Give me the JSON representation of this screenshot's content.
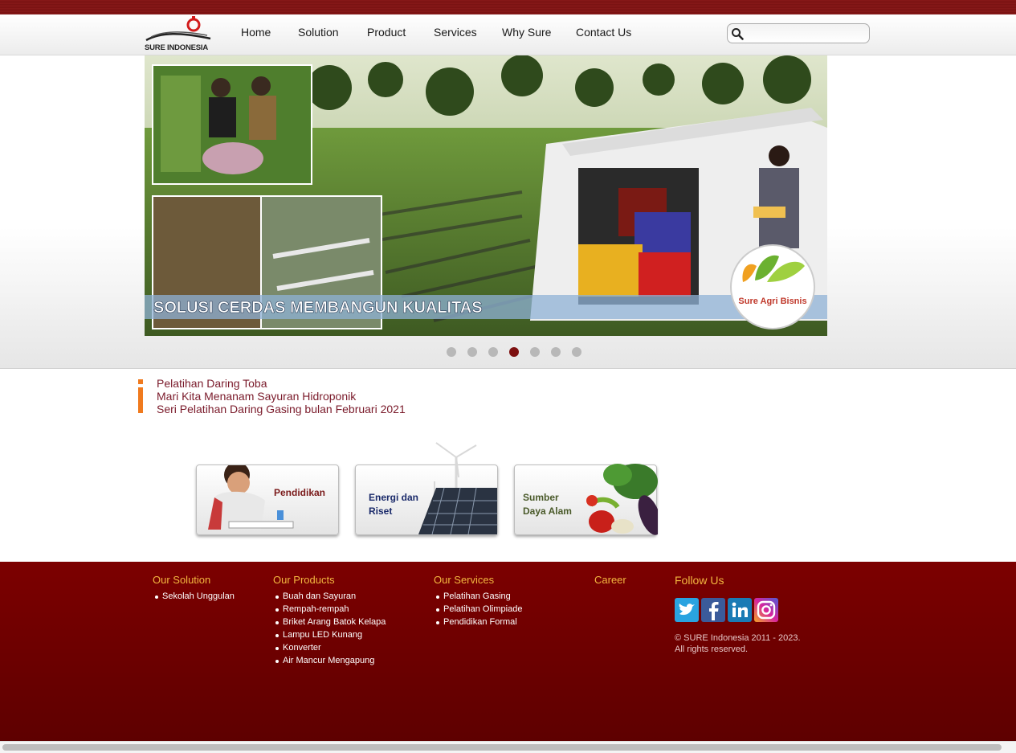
{
  "brand": {
    "name": "SURE INDONESIA",
    "logo_color": "#d21c1c"
  },
  "nav": {
    "items": [
      {
        "label": "Home"
      },
      {
        "label": "Solution"
      },
      {
        "label": "Product"
      },
      {
        "label": "Services"
      },
      {
        "label": "Why Sure"
      },
      {
        "label": "Contact Us"
      }
    ],
    "search_placeholder": "",
    "search_icon": "search-icon"
  },
  "banner": {
    "caption": "SOLUSI CERDAS MEMBANGUN KUALITAS",
    "badge_text": "Sure Agri Bisnis",
    "slide_count": 7,
    "active_slide": 4
  },
  "news": {
    "items": [
      {
        "title": "Pelatihan Daring Toba"
      },
      {
        "title": "Mari Kita Menanam Sayuran Hidroponik"
      },
      {
        "title": "Seri Pelatihan Daring Gasing bulan Februari 2021"
      }
    ]
  },
  "categories": [
    {
      "label": "Pendidikan"
    },
    {
      "label": "Energi dan\nRiset"
    },
    {
      "label": "Sumber\nDaya Alam"
    }
  ],
  "footer": {
    "solution": {
      "heading": "Our Solution",
      "items": [
        "Sekolah Unggulan"
      ]
    },
    "products": {
      "heading": "Our Products",
      "items": [
        "Buah dan Sayuran",
        "Rempah-rempah",
        "Briket Arang Batok Kelapa",
        "Lampu LED Kunang",
        "Konverter",
        "Air Mancur Mengapung"
      ]
    },
    "services": {
      "heading": "Our Services",
      "items": [
        "Pelatihan Gasing",
        "Pelatihan Olimpiade",
        "Pendidikan Formal"
      ]
    },
    "career": {
      "heading": "Career"
    },
    "follow": {
      "heading": "Follow Us",
      "icons": [
        "twitter-icon",
        "facebook-icon",
        "linkedin-icon",
        "instagram-icon"
      ],
      "copyright": "© SURE Indonesia 2011 - 2023.\nAll rights reserved."
    }
  },
  "colors": {
    "brand_dark_red": "#7c0000",
    "footer_heading": "#f3b740",
    "news_text": "#7a1a2a",
    "active_dot": "#7d1010"
  }
}
